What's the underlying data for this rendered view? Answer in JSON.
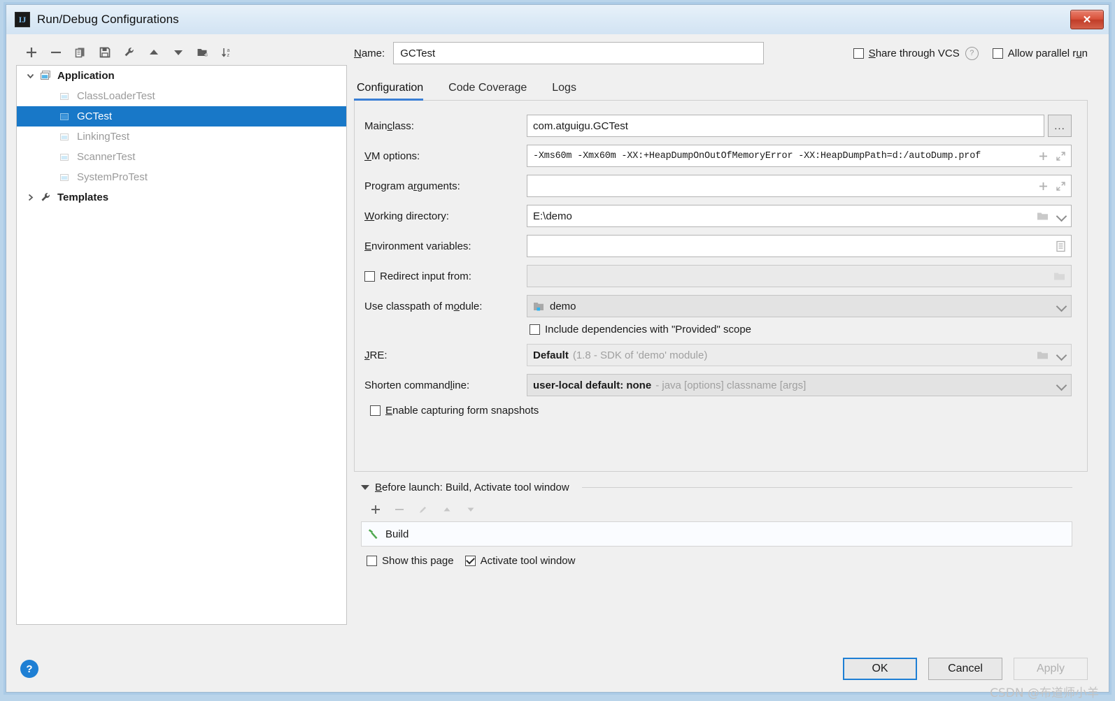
{
  "window": {
    "title": "Run/Debug Configurations",
    "app_icon": "intellij-idea-icon",
    "close_label": "✕"
  },
  "toolbar": {
    "items": [
      {
        "name": "add-configuration-button",
        "icon": "plus-icon"
      },
      {
        "name": "remove-configuration-button",
        "icon": "minus-icon"
      },
      {
        "name": "copy-configuration-button",
        "icon": "copy-icon"
      },
      {
        "name": "save-configuration-button",
        "icon": "save-icon"
      },
      {
        "name": "edit-templates-button",
        "icon": "wrench-icon"
      },
      {
        "name": "move-up-button",
        "icon": "arrow-up-icon"
      },
      {
        "name": "move-down-button",
        "icon": "arrow-down-icon"
      },
      {
        "name": "new-folder-button",
        "icon": "folder-add-icon"
      },
      {
        "name": "sort-configurations-button",
        "icon": "sort-az-icon"
      }
    ]
  },
  "tree": {
    "root": {
      "label": "Application",
      "icon": "application-icon",
      "expanded": true
    },
    "children": [
      {
        "label": "ClassLoaderTest",
        "icon": "run-config-icon",
        "selected": false
      },
      {
        "label": "GCTest",
        "icon": "run-config-icon",
        "selected": true
      },
      {
        "label": "LinkingTest",
        "icon": "run-config-icon",
        "selected": false
      },
      {
        "label": "ScannerTest",
        "icon": "run-config-icon",
        "selected": false
      },
      {
        "label": "SystemProTest",
        "icon": "run-config-icon",
        "selected": false
      }
    ],
    "templates": {
      "label": "Templates",
      "icon": "wrench-icon",
      "expanded": false
    }
  },
  "header": {
    "name_label": "Name:",
    "name_value": "GCTest",
    "share_vcs_label": "Share through VCS",
    "share_vcs_checked": false,
    "help_icon": "question-mark-icon",
    "allow_parallel_label": "Allow parallel run",
    "allow_parallel_checked": false
  },
  "tabs": [
    {
      "label": "Configuration",
      "active": true
    },
    {
      "label": "Code Coverage",
      "active": false
    },
    {
      "label": "Logs",
      "active": false
    }
  ],
  "form": {
    "main_class": {
      "label": "Main class:",
      "value": "com.atguigu.GCTest",
      "browse_label": "..."
    },
    "vm_options": {
      "label": "VM options:",
      "value": "-Xms60m -Xmx60m -XX:+HeapDumpOnOutOfMemoryError -XX:HeapDumpPath=d:/autoDump.prof",
      "macro_icon": "plus-icon",
      "expand_icon": "expand-icon"
    },
    "program_arguments": {
      "label": "Program arguments:",
      "value": "",
      "macro_icon": "plus-icon",
      "expand_icon": "expand-icon"
    },
    "working_directory": {
      "label": "Working directory:",
      "value": "E:\\demo",
      "folder_icon": "folder-icon",
      "dropdown_icon": "chevron-down-icon"
    },
    "environment_variables": {
      "label": "Environment variables:",
      "value": "",
      "editor_icon": "list-editor-icon"
    },
    "redirect_input": {
      "label": "Redirect input from:",
      "checked": false,
      "value": "",
      "folder_icon": "folder-icon"
    },
    "classpath_module": {
      "label": "Use classpath of module:",
      "value": "demo",
      "module_icon": "module-icon",
      "dropdown_icon": "chevron-down-icon"
    },
    "include_provided": {
      "label": "Include dependencies with \"Provided\" scope",
      "checked": false
    },
    "jre": {
      "label": "JRE:",
      "value_strong": "Default",
      "value_hint": "(1.8 - SDK of 'demo' module)",
      "folder_icon": "folder-icon",
      "dropdown_icon": "chevron-down-icon"
    },
    "shorten_command_line": {
      "label": "Shorten command line:",
      "value_strong": "user-local default: none",
      "value_hint": "- java [options] classname [args]",
      "dropdown_icon": "chevron-down-icon"
    },
    "enable_snapshots": {
      "label": "Enable capturing form snapshots",
      "checked": false
    }
  },
  "before_launch": {
    "title": "Before launch: Build, Activate tool window",
    "expanded": true,
    "toolbar": [
      {
        "name": "add-task-button",
        "icon": "plus-icon",
        "enabled": true
      },
      {
        "name": "remove-task-button",
        "icon": "minus-icon",
        "enabled": false
      },
      {
        "name": "edit-task-button",
        "icon": "pencil-icon",
        "enabled": false
      },
      {
        "name": "move-task-up-button",
        "icon": "arrow-up-icon",
        "enabled": false
      },
      {
        "name": "move-task-down-button",
        "icon": "arrow-down-icon",
        "enabled": false
      }
    ],
    "tasks": [
      {
        "label": "Build",
        "icon": "hammer-icon"
      }
    ],
    "show_this_page": {
      "label": "Show this page",
      "checked": false
    },
    "activate_tool_window": {
      "label": "Activate tool window",
      "checked": true
    }
  },
  "footer": {
    "help_icon": "help-circle-icon",
    "ok_label": "OK",
    "cancel_label": "Cancel",
    "apply_label": "Apply",
    "apply_enabled": false,
    "watermark": "CSDN @布道师小羊"
  },
  "colors": {
    "selection_blue": "#1878c8",
    "accent_blue": "#3a7fd5",
    "help_blue": "#1e7fd4",
    "build_green": "#4fa84f",
    "close_red": "#d9503a"
  }
}
